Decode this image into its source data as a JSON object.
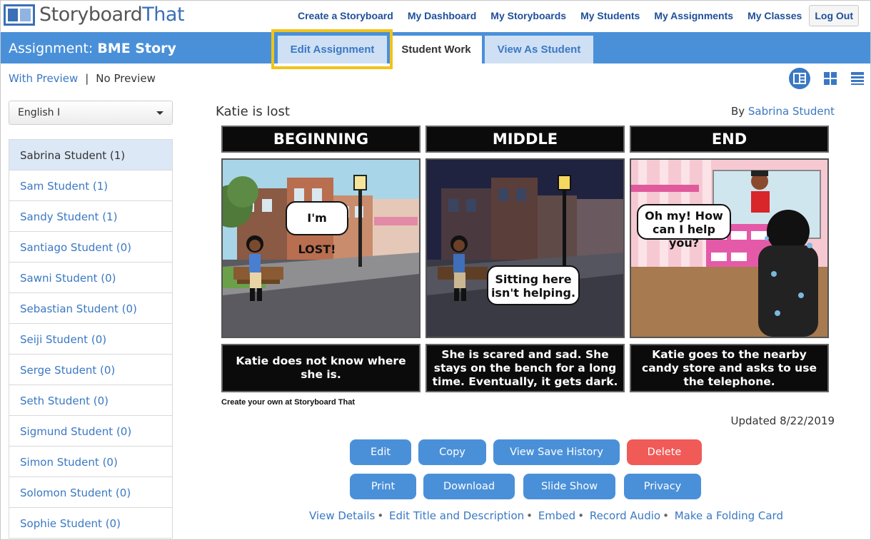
{
  "brand": {
    "part1": "Storyboard",
    "part2": "That"
  },
  "topnav": {
    "items": [
      "Create a Storyboard",
      "My Dashboard",
      "My Storyboards",
      "My Students",
      "My Assignments",
      "My Classes"
    ],
    "logout": "Log Out"
  },
  "assignment": {
    "prefix": "Assignment:",
    "name": "BME Story"
  },
  "tabs": {
    "edit": "Edit Assignment",
    "student_work": "Student Work",
    "view_as_student": "View As Student"
  },
  "preview": {
    "with": "With Preview",
    "separator": "|",
    "without": "No Preview"
  },
  "class_select": {
    "value": "English I"
  },
  "students": [
    "Sabrina Student (1)",
    "Sam Student (1)",
    "Sandy Student (1)",
    "Santiago Student (0)",
    "Sawni Student (0)",
    "Sebastian Student (0)",
    "Seiji Student (0)",
    "Serge Student (0)",
    "Seth Student (0)",
    "Sigmund Student (0)",
    "Simon Student (0)",
    "Solomon Student (0)",
    "Sophie Student (0)"
  ],
  "storyboard": {
    "title": "Katie is lost",
    "by_prefix": "By",
    "author": "Sabrina Student",
    "cells": [
      {
        "heading": "BEGINNING",
        "caption": "Katie does not know where she is.",
        "bubble": "I'm LOST!"
      },
      {
        "heading": "MIDDLE",
        "caption": "She is scared and sad. She stays on the bench for a long time. Eventually, it gets dark.",
        "bubble": "Sitting here isn't helping."
      },
      {
        "heading": "END",
        "caption": "Katie goes to the nearby candy store and asks to use the telephone.",
        "bubble": "Oh my! How can I help you?"
      }
    ],
    "credit": "Create your own at Storyboard That",
    "updated": "Updated 8/22/2019"
  },
  "buttons": {
    "edit": "Edit",
    "copy": "Copy",
    "history": "View Save History",
    "delete": "Delete",
    "print": "Print",
    "download": "Download",
    "slideshow": "Slide Show",
    "privacy": "Privacy"
  },
  "footer_links": [
    "View Details",
    "Edit Title and Description",
    "Embed",
    "Record Audio",
    "Make a Folding Card"
  ],
  "colors": {
    "brand_blue": "#4a90d9",
    "delete_red": "#f05a57",
    "highlight_yellow": "#f2c318"
  }
}
